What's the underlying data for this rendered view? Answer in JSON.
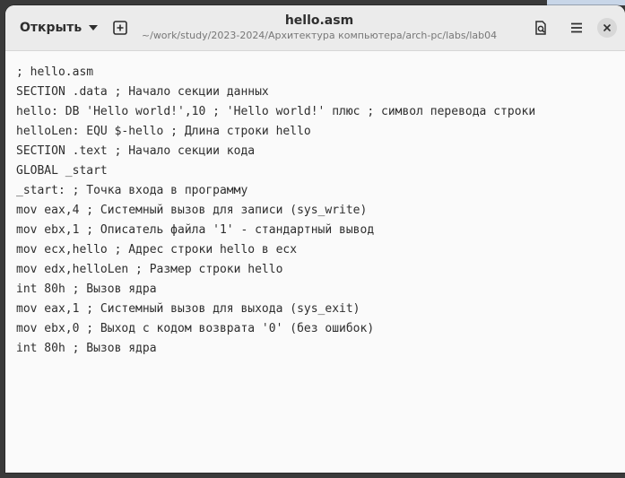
{
  "header": {
    "open_label": "Открыть",
    "title": "hello.asm",
    "path": "~/work/study/2023-2024/Архитектура компьютера/arch-pc/labs/lab04"
  },
  "icons": {
    "open_dropdown": "chevron-down-icon",
    "new_tab": "new-document-icon",
    "search": "find-icon",
    "menu": "hamburger-menu-icon",
    "close": "close-icon"
  },
  "editor": {
    "lines": [
      "; hello.asm",
      "SECTION .data ; Начало секции данных",
      "hello: DB 'Hello world!',10 ; 'Hello world!' плюс ; символ перевода строки",
      "helloLen: EQU $-hello ; Длина строки hello",
      "SECTION .text ; Начало секции кода",
      "GLOBAL _start",
      "_start: ; Точка входа в программу",
      "mov eax,4 ; Системный вызов для записи (sys_write)",
      "mov ebx,1 ; Описатель файла '1' - стандартный вывод",
      "mov ecx,hello ; Адрес строки hello в ecx",
      "mov edx,helloLen ; Размер строки hello",
      "int 80h ; Вызов ядра",
      "mov eax,1 ; Системный вызов для выхода (sys_exit)",
      "mov ebx,0 ; Выход с кодом возврата '0' (без ошибок)",
      "int 80h ; Вызов ядра"
    ]
  }
}
